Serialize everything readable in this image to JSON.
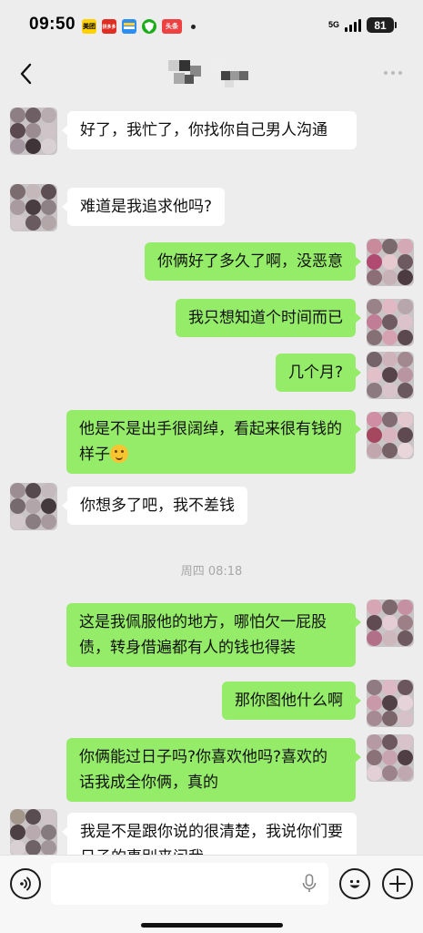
{
  "status_bar": {
    "time": "09:50",
    "app_icons": [
      {
        "name": "meituan-icon",
        "label": "美团",
        "color": "#ffd100",
        "text_color": "#000"
      },
      {
        "name": "pinduoduo-icon",
        "label": "拼多多",
        "color": "#e02e24",
        "text_color": "#fff"
      },
      {
        "name": "alipay-card-icon",
        "label": "",
        "color": "#2b8ef0",
        "text_color": "#fff"
      },
      {
        "name": "shield-icon",
        "label": "",
        "color": "#1aad19",
        "text_color": "#fff"
      },
      {
        "name": "toutiao-icon",
        "label": "头条",
        "color": "#f04142",
        "text_color": "#fff"
      }
    ],
    "network": "5G",
    "battery": "81"
  },
  "nav": {
    "back_icon": "chevron-left-icon",
    "more_icon": "more-dots-icon"
  },
  "messages": [
    {
      "side": "left",
      "text": "好了，我忙了，你找你自己男人沟通"
    },
    {
      "side": "left",
      "text": "难道是我追求他吗?"
    },
    {
      "side": "right",
      "text": "你俩好了多久了啊，没恶意"
    },
    {
      "side": "right",
      "text": "我只想知道个时间而已"
    },
    {
      "side": "right",
      "text": "几个月?"
    },
    {
      "side": "right",
      "text": "他是不是出手很阔绰，看起来很有钱的样子",
      "emoji": "thinking-face-icon"
    },
    {
      "side": "left",
      "text": "你想多了吧，我不差钱"
    },
    {
      "side": "right",
      "text": "这是我佩服他的地方，哪怕欠一屁股债，转身借遍都有人的钱也得装"
    },
    {
      "side": "right",
      "text": "那你图他什么啊"
    },
    {
      "side": "right",
      "text": "你俩能过日子吗?你喜欢他吗?喜欢的话我成全你俩，真的"
    },
    {
      "side": "left",
      "text": "我是不是跟你说的很清楚，我说你们要日子的事别来问我"
    }
  ],
  "timestamp": "周四 08:18",
  "input_bar": {
    "voice_icon": "voice-icon",
    "mic_icon": "mic-icon",
    "emoji_icon": "emoji-icon",
    "plus_icon": "plus-icon",
    "placeholder": ""
  },
  "colors": {
    "background": "#ededed",
    "bubble_left": "#ffffff",
    "bubble_right": "#95ec69"
  }
}
